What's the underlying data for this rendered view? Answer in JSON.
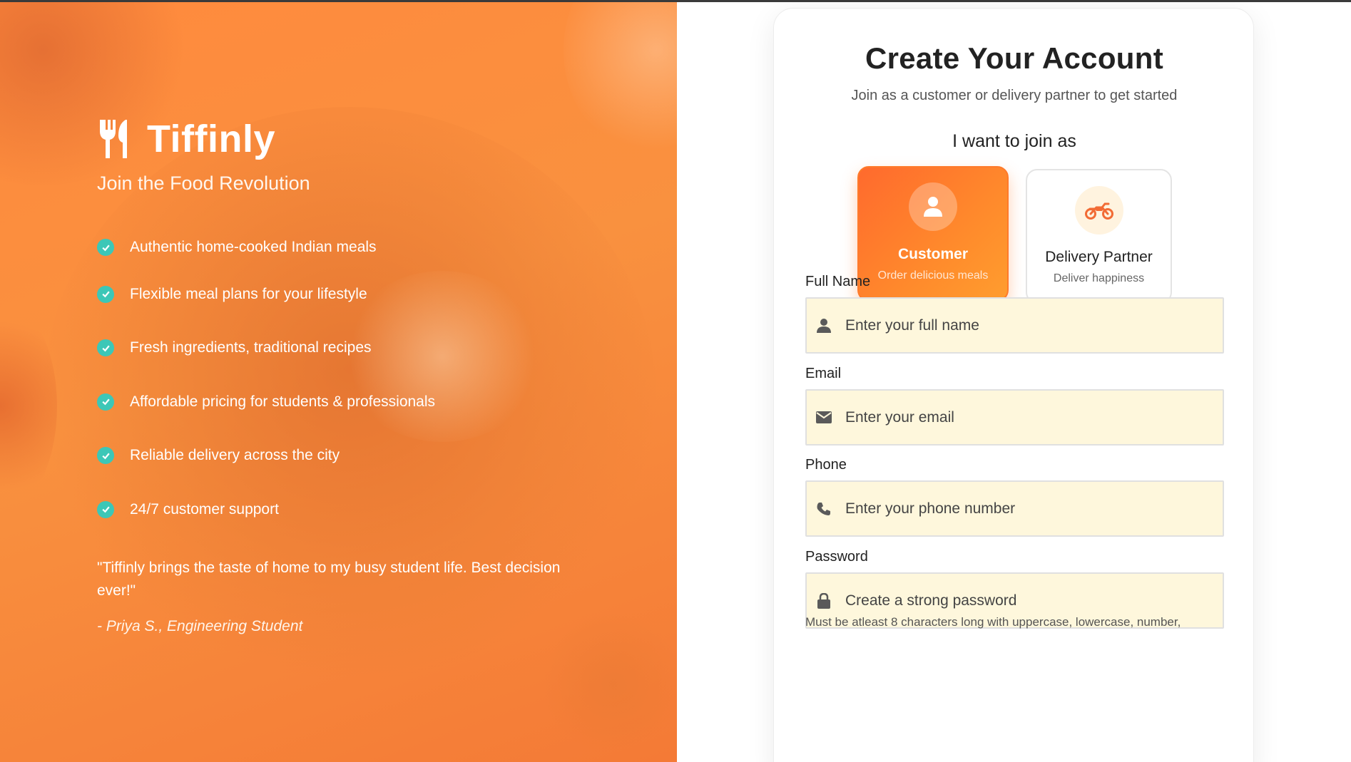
{
  "hero": {
    "brand": "Tiffinly",
    "tagline": "Join the Food Revolution",
    "features": [
      "Authentic home-cooked Indian meals",
      "Flexible meal plans for your lifestyle",
      "Fresh ingredients, traditional recipes",
      "Affordable pricing for students & professionals",
      "Reliable delivery across the city",
      "24/7 customer support"
    ],
    "quote": "\"Tiffinly brings the taste of home to my busy student life. Best decision ever!\"",
    "author": "- Priya S., Engineering Student"
  },
  "form": {
    "title": "Create Your Account",
    "subtitle": "Join as a customer or delivery partner to get started",
    "join_label": "I want to join as",
    "roles": [
      {
        "title": "Customer",
        "desc": "Order delicious meals",
        "icon": "user-icon",
        "selected": true
      },
      {
        "title": "Delivery Partner",
        "desc": "Deliver happiness",
        "icon": "motorcycle-icon",
        "selected": false
      }
    ],
    "fields": {
      "full_name": {
        "label": "Full Name",
        "placeholder": "Enter your full name",
        "icon": "user-icon"
      },
      "email": {
        "label": "Email",
        "placeholder": "Enter your email",
        "icon": "envelope-icon"
      },
      "phone": {
        "label": "Phone",
        "placeholder": "Enter your phone number",
        "icon": "phone-icon"
      },
      "password": {
        "label": "Password",
        "placeholder": "Create a strong password",
        "icon": "lock-icon"
      }
    },
    "password_hint": "Must be atleast 8 characters long with uppercase, lowercase, number,"
  },
  "colors": {
    "accent": "#ff7a2a",
    "check": "#3cc7b7",
    "input_bg": "#fef7dc"
  }
}
